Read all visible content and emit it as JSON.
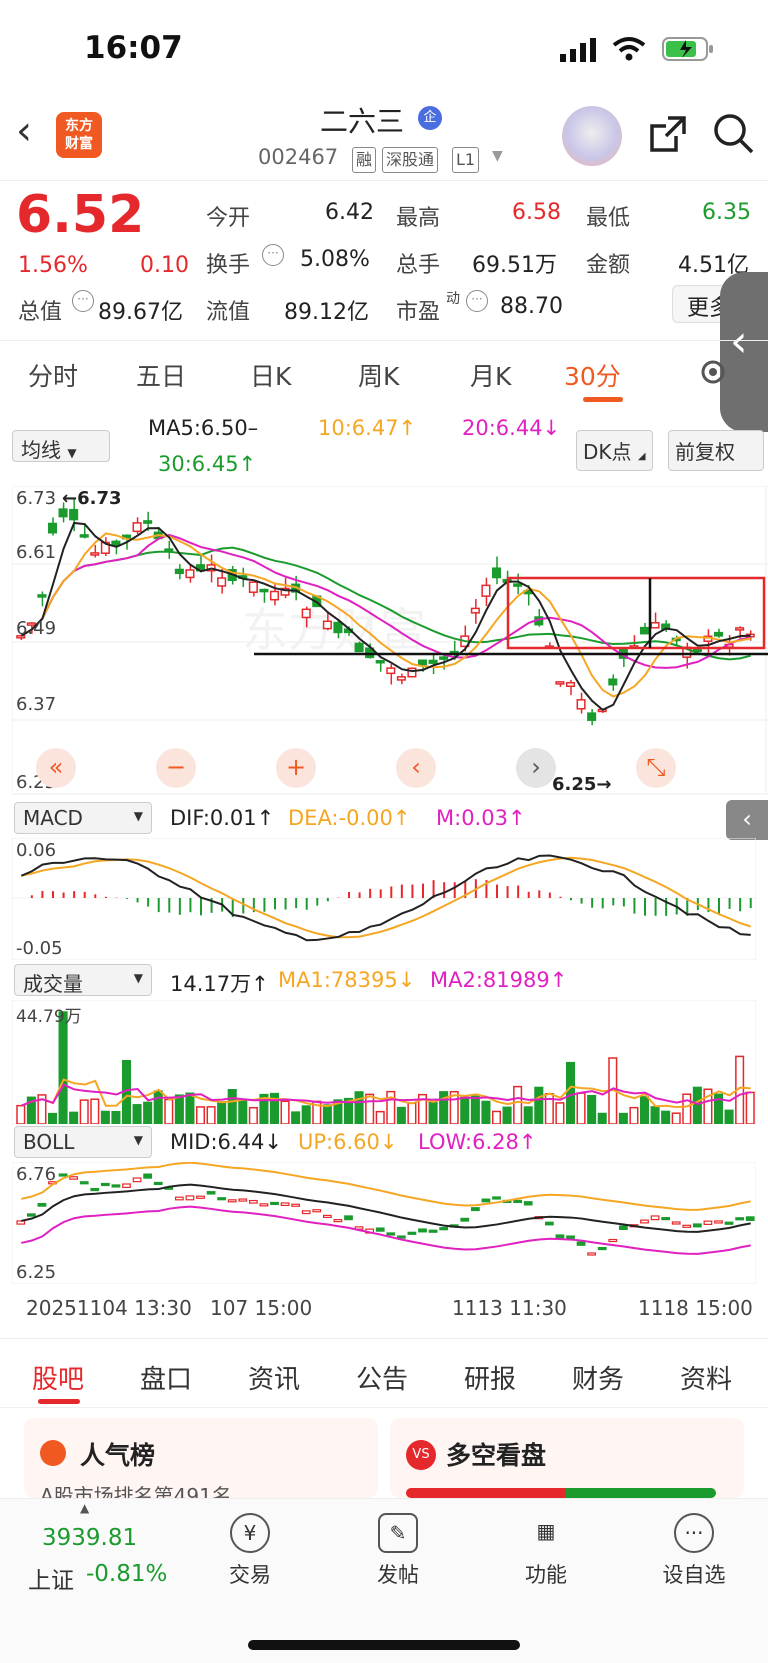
{
  "status": {
    "time": "16:07"
  },
  "header": {
    "name": "二六三",
    "badge": "企",
    "code": "002467",
    "tags": [
      "融",
      "深股通",
      "L1"
    ],
    "logo": "东方\n财富"
  },
  "quote": {
    "price": "6.52",
    "pct": "1.56%",
    "change": "0.10",
    "rows": [
      [
        {
          "label": "今开",
          "value": "6.42",
          "color": "default"
        },
        {
          "label": "最高",
          "value": "6.58",
          "color": "red"
        },
        {
          "label": "最低",
          "value": "6.35",
          "color": "green"
        }
      ],
      [
        {
          "label": "换手",
          "value": "5.08%",
          "color": "default"
        },
        {
          "label": "总手",
          "value": "69.51万",
          "color": "default"
        },
        {
          "label": "金额",
          "value": "4.51亿",
          "color": "default"
        }
      ],
      [
        {
          "label": "流值",
          "value": "89.12亿",
          "color": "default"
        },
        {
          "label": "市盈",
          "value": "88.70",
          "color": "default"
        }
      ]
    ],
    "total_label": "总值",
    "total_value": "89.67亿",
    "more": "更多",
    "pe_sup": "动"
  },
  "tabs": [
    "分时",
    "五日",
    "日K",
    "周K",
    "月K",
    "30分"
  ],
  "ma": {
    "select": "均线",
    "ma5": "MA5:6.50–",
    "ma10": "10:6.47↑",
    "ma20": "20:6.44↓",
    "ma30": "30:6.45↑",
    "dk": "DK点",
    "fq": "前复权"
  },
  "kline": {
    "ylabels": [
      "6.73",
      "6.61",
      "6.49",
      "6.37",
      "6.25"
    ],
    "high_mark": "←6.73",
    "low_mark": "6.25→"
  },
  "macd": {
    "select": "MACD",
    "dif": "DIF:0.01↑",
    "dea": "DEA:-0.00↑",
    "m": "M:0.03↑",
    "top": "0.06",
    "bottom": "-0.05"
  },
  "vol": {
    "select": "成交量",
    "v": "14.17万↑",
    "ma1": "MA1:78395↓",
    "ma2": "MA2:81989↑",
    "top": "44.79万"
  },
  "boll": {
    "select": "BOLL",
    "mid": "MID:6.44↓",
    "up": "UP:6.60↓",
    "low": "LOW:6.28↑",
    "top": "6.76",
    "bottom": "6.25"
  },
  "dates": [
    "20251104 13:30",
    "107 15:00",
    "1113 11:30",
    "1118 15:00"
  ],
  "bottom_tabs": [
    "股吧",
    "盘口",
    "资讯",
    "公告",
    "研报",
    "财务",
    "资料"
  ],
  "cards": {
    "left": "人气榜",
    "left_sub": "A股市场排名第491名",
    "right": "多空看盘"
  },
  "nav": {
    "index_value": "3939.81",
    "index_label": "上证",
    "index_pct": "-0.81%",
    "items": [
      "交易",
      "发帖",
      "功能",
      "设自选"
    ]
  },
  "colors": {
    "red": "#e5282b",
    "green": "#1b9b2e",
    "orange": "#f5a623",
    "magenta": "#e020c0",
    "accent": "#f05a22"
  }
}
